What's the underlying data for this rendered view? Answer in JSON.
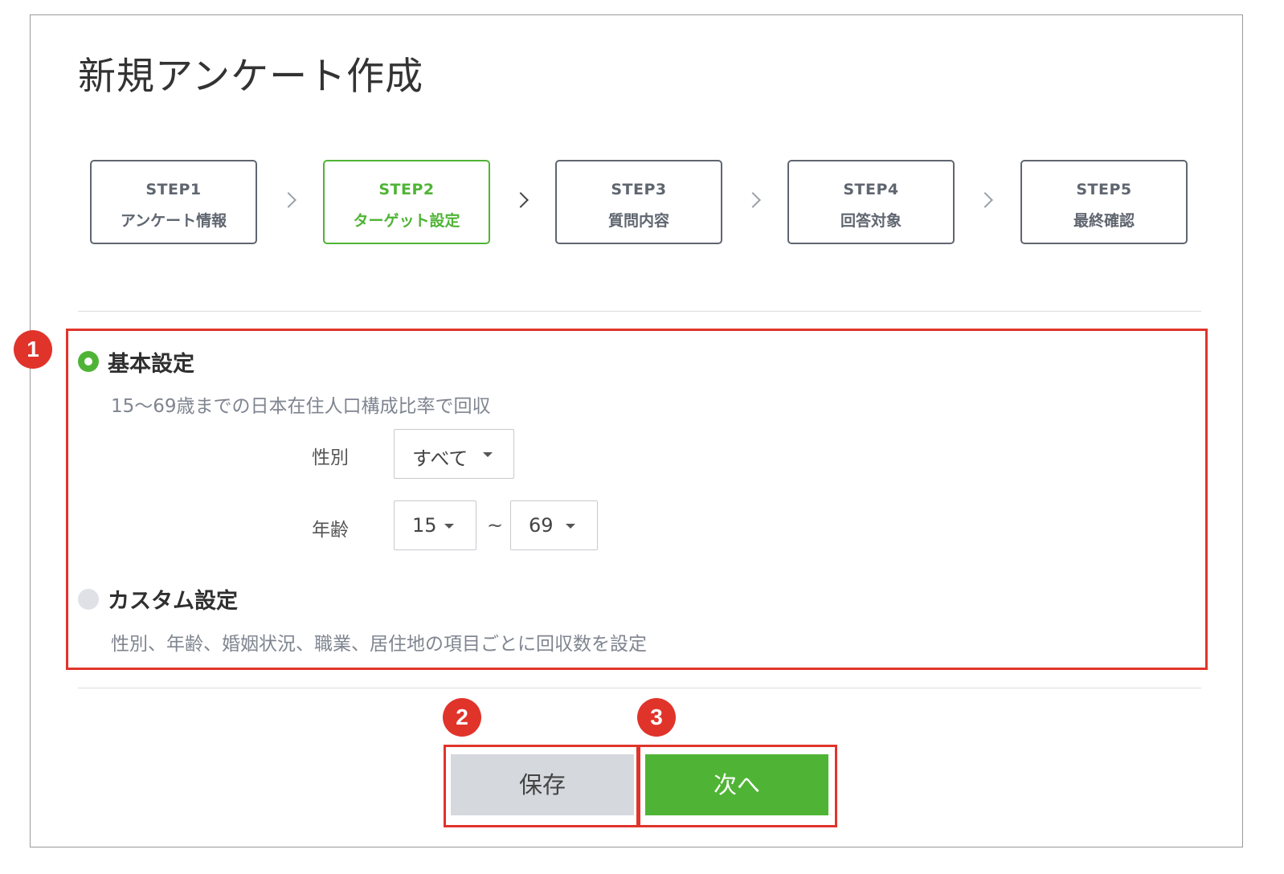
{
  "page": {
    "title": "新規アンケート作成"
  },
  "steps": [
    {
      "number": "STEP1",
      "name": "アンケート情報",
      "active": false
    },
    {
      "number": "STEP2",
      "name": "ターゲット設定",
      "active": true
    },
    {
      "number": "STEP3",
      "name": "質問内容",
      "active": false
    },
    {
      "number": "STEP4",
      "name": "回答対象",
      "active": false
    },
    {
      "number": "STEP5",
      "name": "最終確認",
      "active": false
    }
  ],
  "target": {
    "basic": {
      "title": "基本設定",
      "selected": true,
      "description": "15〜69歳までの日本在住人口構成比率で回収",
      "gender_label": "性別",
      "gender_value": "すべて",
      "age_label": "年齢",
      "age_from": "15",
      "age_separator": "~",
      "age_to": "69"
    },
    "custom": {
      "title": "カスタム設定",
      "selected": false,
      "description": "性別、年齢、婚姻状況、職業、居住地の項目ごとに回収数を設定"
    }
  },
  "actions": {
    "save_label": "保存",
    "next_label": "次へ"
  },
  "annotations": {
    "badge_1": "1",
    "badge_2": "2",
    "badge_3": "3"
  },
  "colors": {
    "accent": "#4fb435",
    "callout": "#e0342b",
    "step_border": "#5f6670",
    "save_bg": "#d5d8dd"
  }
}
